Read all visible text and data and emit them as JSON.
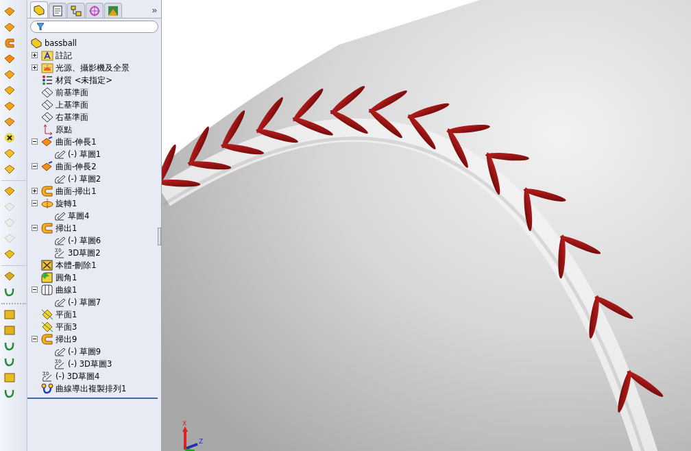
{
  "toolbar": [
    {
      "kind": "extrude-surface",
      "disabled": false
    },
    {
      "kind": "revolve",
      "disabled": false
    },
    {
      "kind": "sweep",
      "disabled": false
    },
    {
      "kind": "loft",
      "disabled": false
    },
    {
      "kind": "plane-surface",
      "disabled": false
    },
    {
      "kind": "offset",
      "disabled": false
    },
    {
      "kind": "copy",
      "disabled": false
    },
    {
      "kind": "bend",
      "disabled": false
    },
    {
      "kind": "delete",
      "disabled": false
    },
    {
      "kind": "box",
      "disabled": false
    },
    {
      "kind": "knit",
      "disabled": false
    },
    {
      "kind": "offset",
      "disabled": false
    },
    {
      "kind": "offset",
      "disabled": true
    },
    {
      "kind": "offset",
      "disabled": true
    },
    {
      "kind": "offset",
      "disabled": true
    },
    {
      "kind": "fillet",
      "disabled": false
    },
    {
      "kind": "point",
      "disabled": false
    },
    {
      "kind": "curve",
      "disabled": false
    }
  ],
  "toolbar_lower": [
    {
      "kind": "sketch-face"
    },
    {
      "kind": "split"
    },
    {
      "kind": "line"
    },
    {
      "kind": "curve"
    },
    {
      "kind": "fillet"
    },
    {
      "kind": "helix"
    }
  ],
  "panel": {
    "tabs": [
      {
        "kind": "feature-tree",
        "selected": true
      },
      {
        "kind": "property",
        "selected": false
      },
      {
        "kind": "config",
        "selected": false
      },
      {
        "kind": "dimension",
        "selected": false
      },
      {
        "kind": "display",
        "selected": false
      }
    ],
    "more": "»"
  },
  "tree": {
    "label": "bassball",
    "kind": "part",
    "children": [
      {
        "label": "註記",
        "kind": "annotation",
        "expanded": false
      },
      {
        "label": "光源、攝影機及全景",
        "kind": "lights",
        "expanded": false
      },
      {
        "label": "材質 <未指定>",
        "kind": "material"
      },
      {
        "label": "前基準面",
        "kind": "plane"
      },
      {
        "label": "上基準面",
        "kind": "plane"
      },
      {
        "label": "右基準面",
        "kind": "plane"
      },
      {
        "label": "原點",
        "kind": "origin"
      },
      {
        "label": "曲面-伸長1",
        "kind": "extrude",
        "expanded": true,
        "children": [
          {
            "label": "(-) 草圖1",
            "kind": "sketch"
          }
        ]
      },
      {
        "label": "曲面-伸長2",
        "kind": "extrude",
        "expanded": true,
        "children": [
          {
            "label": "(-) 草圖2",
            "kind": "sketch"
          }
        ]
      },
      {
        "label": "曲面-掃出1",
        "kind": "sweep",
        "expanded": false
      },
      {
        "label": "旋轉1",
        "kind": "revolve",
        "expanded": true,
        "children": [
          {
            "label": "草圖4",
            "kind": "sketch"
          }
        ]
      },
      {
        "label": "掃出1",
        "kind": "sweep",
        "expanded": true,
        "children": [
          {
            "label": "(-) 草圖6",
            "kind": "sketch"
          },
          {
            "label": "3D草圖2",
            "kind": "sketch3d"
          }
        ]
      },
      {
        "label": "本體-刪除1",
        "kind": "delete-body"
      },
      {
        "label": "圓角1",
        "kind": "fillet"
      },
      {
        "label": "曲線1",
        "kind": "curve",
        "expanded": true,
        "children": [
          {
            "label": "(-) 草圖7",
            "kind": "sketch"
          }
        ]
      },
      {
        "label": "平面1",
        "kind": "refplane"
      },
      {
        "label": "平面3",
        "kind": "refplane"
      },
      {
        "label": "掃出9",
        "kind": "sweep",
        "expanded": true,
        "children": [
          {
            "label": "(-) 草圖9",
            "kind": "sketch"
          },
          {
            "label": "(-) 3D草圖3",
            "kind": "sketch3d"
          }
        ]
      },
      {
        "label": "(-) 3D草圖4",
        "kind": "sketch3d"
      },
      {
        "label": "曲線導出複製排列1",
        "kind": "pattern"
      }
    ]
  },
  "triad": {
    "x_label": "X",
    "z_label": "Z"
  }
}
